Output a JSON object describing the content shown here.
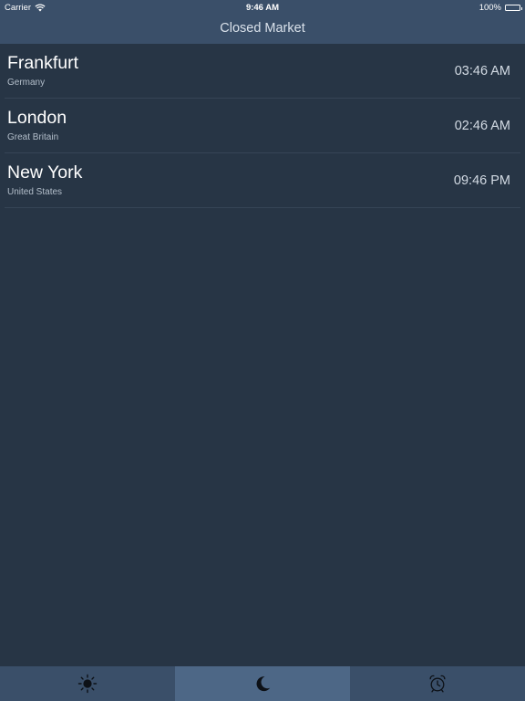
{
  "status_bar": {
    "carrier": "Carrier",
    "time": "9:46 AM",
    "battery": "100%",
    "battery_level": 1.0
  },
  "header": {
    "title": "Closed Market"
  },
  "markets": [
    {
      "city": "Frankfurt",
      "country": "Germany",
      "time": "03:46 AM"
    },
    {
      "city": "London",
      "country": "Great Britain",
      "time": "02:46 AM"
    },
    {
      "city": "New York",
      "country": "United States",
      "time": "09:46 PM"
    }
  ],
  "tabs": [
    {
      "icon": "sun-icon",
      "active": false
    },
    {
      "icon": "moon-icon",
      "active": true
    },
    {
      "icon": "alarm-clock-icon",
      "active": false
    }
  ],
  "colors": {
    "background": "#273545",
    "bar": "#3a4f69",
    "active_tab": "#4d6786"
  }
}
